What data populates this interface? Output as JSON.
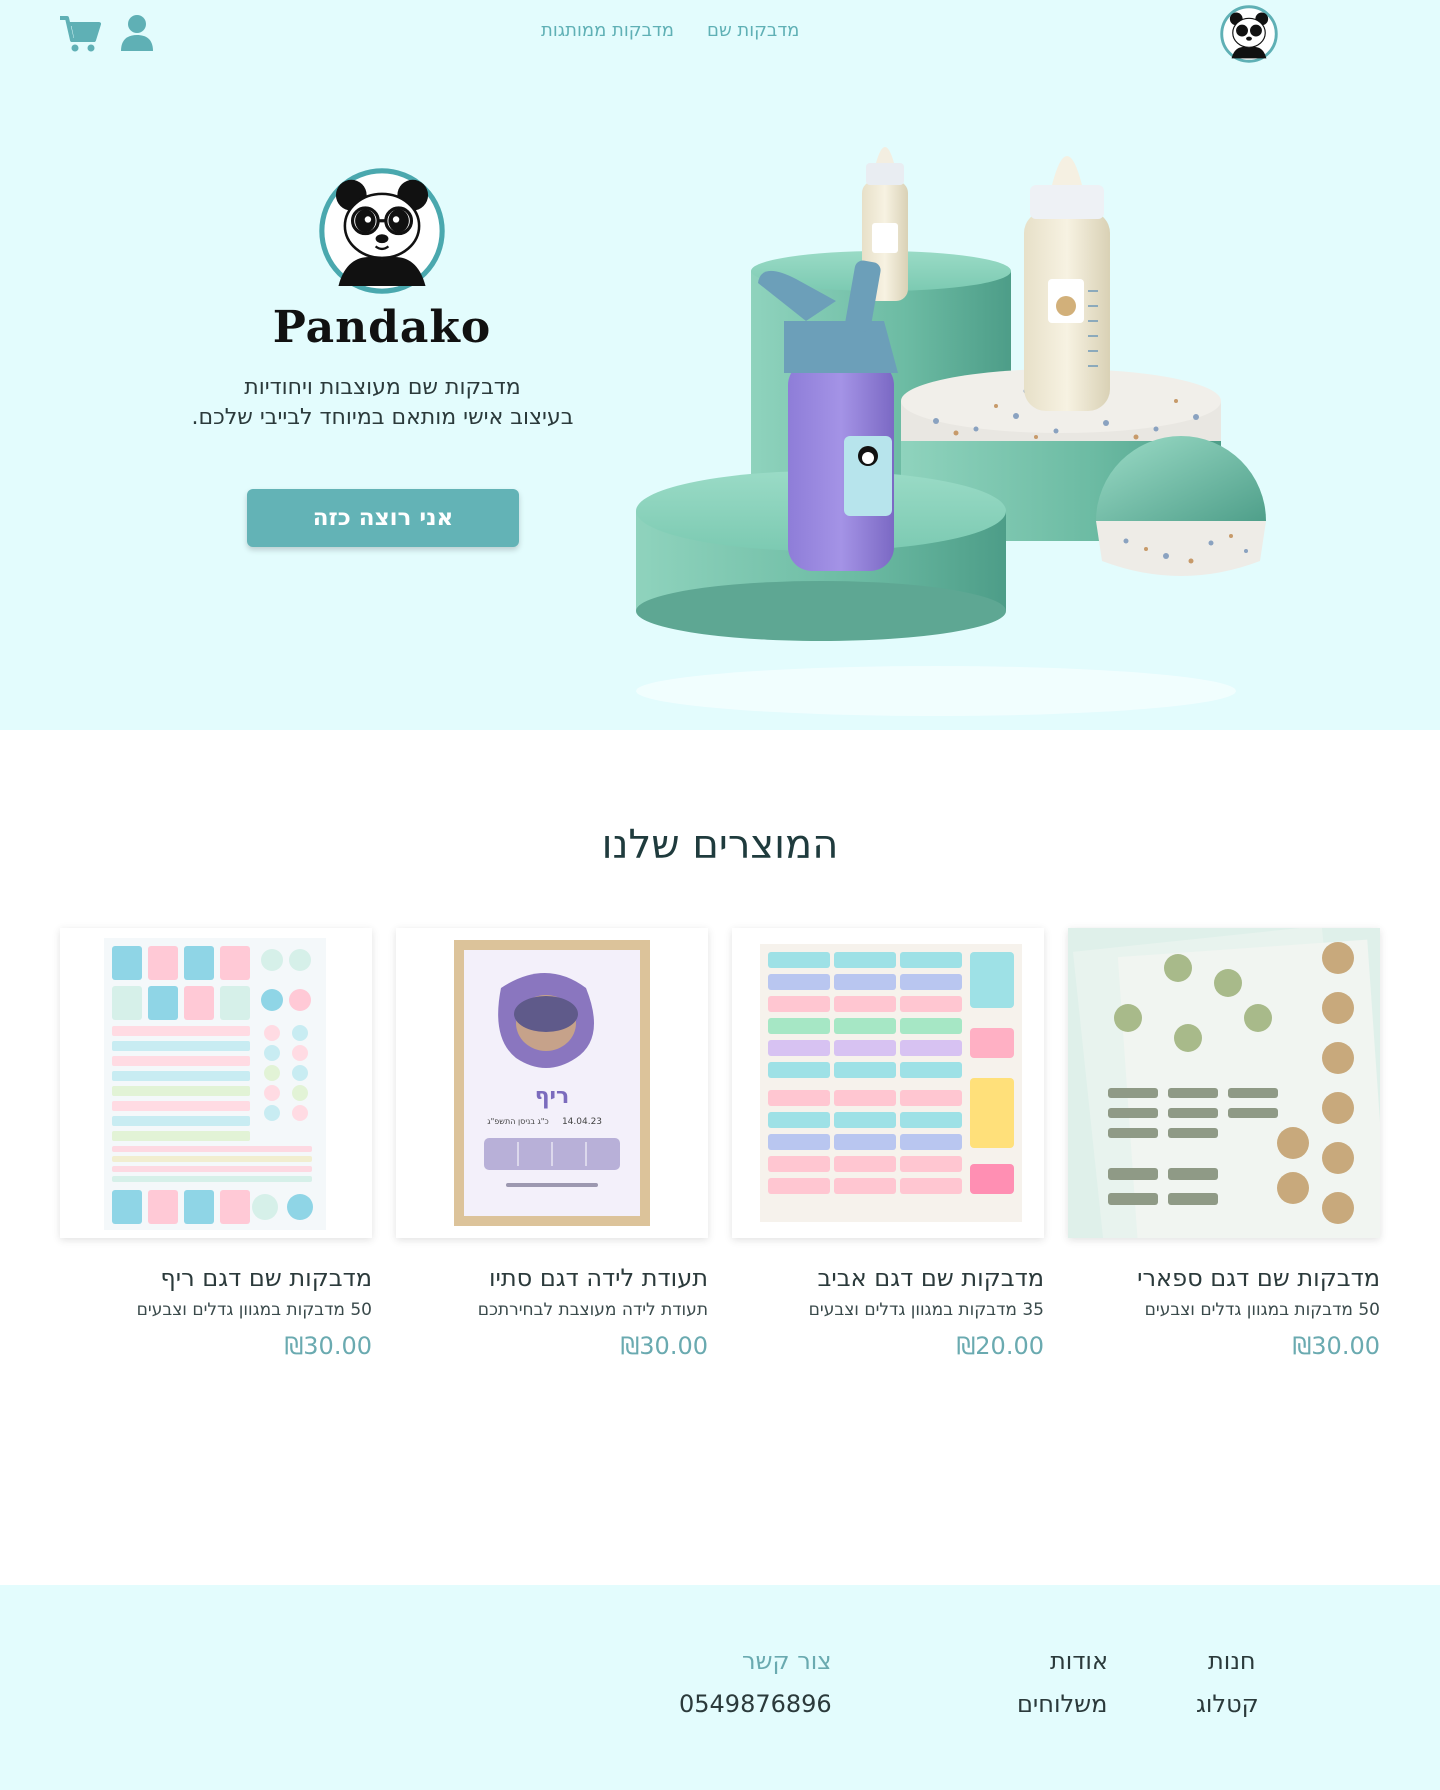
{
  "header": {
    "nav": [
      {
        "label": "מדבקות שם"
      },
      {
        "label": "מדבקות ממותגות"
      }
    ],
    "icons": {
      "cart": "cart-icon",
      "account": "account-icon",
      "logo": "panda-logo"
    }
  },
  "hero": {
    "brand": "Pandako",
    "tagline_line1": "מדבקות שם מעוצבות ויחודיות",
    "tagline_line2": "בעיצוב אישי מותאם במיוחד לבייבי שלכם.",
    "cta": "אני רוצה כזה"
  },
  "products": {
    "title": "המוצרים שלנו",
    "items": [
      {
        "title": "מדבקות שם דגם ספארי",
        "desc": "50 מדבקות במגוון גדלים וצבעים",
        "price": "₪30.00"
      },
      {
        "title": "מדבקות שם דגם אביב",
        "desc": "35 מדבקות במגוון גדלים וצבעים",
        "price": "₪20.00"
      },
      {
        "title": "תעודת לידה דגם סתיו",
        "desc": "תעודת לידה מעוצבת לבחירתכם",
        "price": "₪30.00"
      },
      {
        "title": "מדבקות שם דגם ריף",
        "desc": "50 מדבקות במגוון גדלים וצבעים",
        "price": "₪30.00"
      }
    ],
    "certificate": {
      "name": "ריף",
      "date": "14.04.23",
      "hebrew_date": "כ\"ג בניסן התשפ\"ג"
    }
  },
  "footer": {
    "col1": [
      "חנות",
      "קטלוג"
    ],
    "col2": [
      "אודות",
      "משלוחים"
    ],
    "contact_title": "צור קשר",
    "phone": "0549876896"
  },
  "colors": {
    "accent": "#63b3b6",
    "hero_bg": "#e3fcfd",
    "price": "#6aaab0"
  }
}
